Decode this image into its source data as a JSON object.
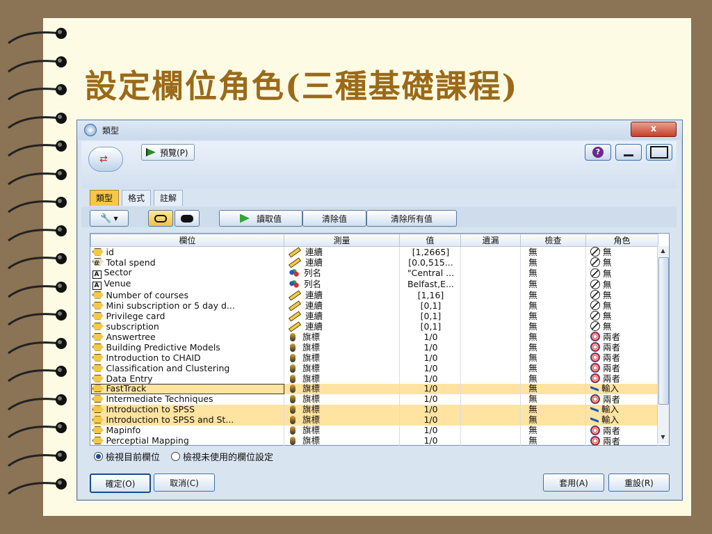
{
  "slide_title": "設定欄位角色(三種基礎課程)",
  "window": {
    "title": "類型",
    "close_label": "x",
    "preview_label": "預覽(P)"
  },
  "tabs": [
    "類型",
    "格式",
    "註解"
  ],
  "toolbar": {
    "read_values": "讀取值",
    "clear_values": "清除值",
    "clear_all_values": "清除所有值"
  },
  "columns": [
    "欄位",
    "測量",
    "值",
    "遺漏",
    "檢查",
    "角色"
  ],
  "rows": [
    {
      "field": "id",
      "measure": "連續",
      "value": "[1,2665]",
      "missing": "",
      "check": "無",
      "role": "無",
      "ftype": "hex",
      "mtype": "cont",
      "rtype": "none"
    },
    {
      "field": "Total spend",
      "measure": "連續",
      "value": "[0.0,515...",
      "missing": "",
      "check": "無",
      "role": "無",
      "ftype": "hash",
      "mtype": "cont",
      "rtype": "none"
    },
    {
      "field": "Sector",
      "measure": "列名",
      "value": "\"Central ...",
      "missing": "",
      "check": "無",
      "role": "無",
      "ftype": "A",
      "mtype": "nom",
      "rtype": "none"
    },
    {
      "field": "Venue",
      "measure": "列名",
      "value": "Belfast,E...",
      "missing": "",
      "check": "無",
      "role": "無",
      "ftype": "A",
      "mtype": "nom",
      "rtype": "none"
    },
    {
      "field": "Number of courses",
      "measure": "連續",
      "value": "[1,16]",
      "missing": "",
      "check": "無",
      "role": "無",
      "ftype": "hex",
      "mtype": "cont",
      "rtype": "none"
    },
    {
      "field": "Mini subscription or 5 day d...",
      "measure": "連續",
      "value": "[0,1]",
      "missing": "",
      "check": "無",
      "role": "無",
      "ftype": "hex",
      "mtype": "cont",
      "rtype": "none"
    },
    {
      "field": "Privilege card",
      "measure": "連續",
      "value": "[0,1]",
      "missing": "",
      "check": "無",
      "role": "無",
      "ftype": "hex",
      "mtype": "cont",
      "rtype": "none"
    },
    {
      "field": "subscription",
      "measure": "連續",
      "value": "[0,1]",
      "missing": "",
      "check": "無",
      "role": "無",
      "ftype": "hex",
      "mtype": "cont",
      "rtype": "none"
    },
    {
      "field": "Answertree",
      "measure": "旗標",
      "value": "1/0",
      "missing": "",
      "check": "無",
      "role": "兩者",
      "ftype": "hex",
      "mtype": "flag",
      "rtype": "both"
    },
    {
      "field": "Building Predictive Models",
      "measure": "旗標",
      "value": "1/0",
      "missing": "",
      "check": "無",
      "role": "兩者",
      "ftype": "hex",
      "mtype": "flag",
      "rtype": "both"
    },
    {
      "field": "Introduction to CHAID",
      "measure": "旗標",
      "value": "1/0",
      "missing": "",
      "check": "無",
      "role": "兩者",
      "ftype": "hex",
      "mtype": "flag",
      "rtype": "both"
    },
    {
      "field": "Classification and Clustering",
      "measure": "旗標",
      "value": "1/0",
      "missing": "",
      "check": "無",
      "role": "兩者",
      "ftype": "hex",
      "mtype": "flag",
      "rtype": "both"
    },
    {
      "field": "Data Entry",
      "measure": "旗標",
      "value": "1/0",
      "missing": "",
      "check": "無",
      "role": "兩者",
      "ftype": "hex",
      "mtype": "flag",
      "rtype": "both"
    },
    {
      "field": "FastTrack",
      "measure": "旗標",
      "value": "1/0",
      "missing": "",
      "check": "無",
      "role": "輸入",
      "ftype": "hex",
      "mtype": "flag",
      "rtype": "input",
      "highlight": true,
      "selected": true
    },
    {
      "field": "Intermediate Techniques",
      "measure": "旗標",
      "value": "1/0",
      "missing": "",
      "check": "無",
      "role": "兩者",
      "ftype": "hex",
      "mtype": "flag",
      "rtype": "both"
    },
    {
      "field": "Introduction to SPSS",
      "measure": "旗標",
      "value": "1/0",
      "missing": "",
      "check": "無",
      "role": "輸入",
      "ftype": "hex",
      "mtype": "flag",
      "rtype": "input",
      "highlight": true
    },
    {
      "field": "Introduction to SPSS and St...",
      "measure": "旗標",
      "value": "1/0",
      "missing": "",
      "check": "無",
      "role": "輸入",
      "ftype": "hex",
      "mtype": "flag",
      "rtype": "input",
      "highlight": true
    },
    {
      "field": "Mapinfo",
      "measure": "旗標",
      "value": "1/0",
      "missing": "",
      "check": "無",
      "role": "兩者",
      "ftype": "hex",
      "mtype": "flag",
      "rtype": "both"
    },
    {
      "field": "Perceptial Mapping",
      "measure": "旗標",
      "value": "1/0",
      "missing": "",
      "check": "無",
      "role": "兩者",
      "ftype": "hex",
      "mtype": "flag",
      "rtype": "both"
    }
  ],
  "radios": {
    "current": "檢視目前欄位",
    "unused": "檢視未使用的欄位設定"
  },
  "buttons": {
    "ok": "確定(O)",
    "cancel": "取消(C)",
    "apply": "套用(A)",
    "reset": "重設(R)"
  },
  "colors": {
    "accent_tab": "#f6c74a",
    "highlight_row": "#ffe3a0",
    "title_text": "#9a6a1a"
  }
}
